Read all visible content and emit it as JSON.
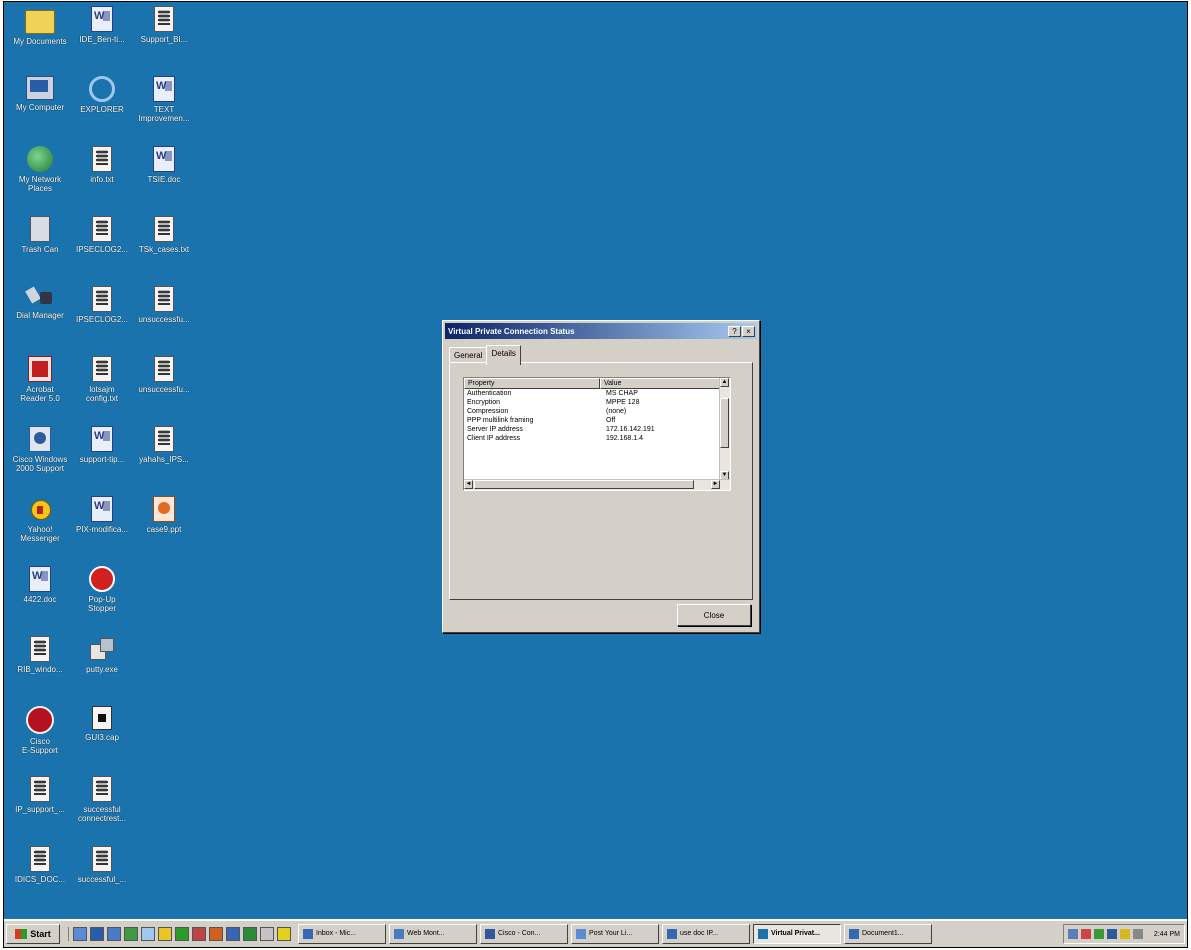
{
  "desktop": {
    "background_color": "#1a73ad",
    "icons": [
      {
        "label": "My Documents",
        "icon": "folder-icon",
        "col": 0,
        "row": 0
      },
      {
        "label": "IDE_Ben-ti...",
        "icon": "word-doc-icon",
        "col": 1,
        "row": 0
      },
      {
        "label": "Support_BI...",
        "icon": "text-file-icon",
        "col": 2,
        "row": 0
      },
      {
        "label": "My Computer",
        "icon": "computer-icon",
        "col": 0,
        "row": 1
      },
      {
        "label": "EXPLORER",
        "icon": "internet-explorer-icon",
        "col": 1,
        "row": 1
      },
      {
        "label": "TEXT\nImprovemen...",
        "icon": "word-doc-icon",
        "col": 2,
        "row": 1
      },
      {
        "label": "My Network\nPlaces",
        "icon": "network-places-icon",
        "col": 0,
        "row": 2
      },
      {
        "label": "info.txt",
        "icon": "text-file-icon",
        "col": 1,
        "row": 2
      },
      {
        "label": "TSIE.doc",
        "icon": "word-doc-icon",
        "col": 2,
        "row": 2
      },
      {
        "label": "Trash Can",
        "icon": "recycle-bin-icon",
        "col": 0,
        "row": 3
      },
      {
        "label": "IPSECLOG2...",
        "icon": "text-file-icon",
        "col": 1,
        "row": 3
      },
      {
        "label": "TSk_cases.txt",
        "icon": "text-file-icon",
        "col": 2,
        "row": 3
      },
      {
        "label": "Dial Manager",
        "icon": "dial-manager-icon",
        "col": 0,
        "row": 4
      },
      {
        "label": "IPSECLOG2...",
        "icon": "text-file-icon",
        "col": 1,
        "row": 4
      },
      {
        "label": "unsuccessfu...",
        "icon": "text-file-icon",
        "col": 2,
        "row": 4
      },
      {
        "label": "Acrobat\nReader 5.0",
        "icon": "acrobat-icon",
        "col": 0,
        "row": 5
      },
      {
        "label": "lotsajm\nconfig.txt",
        "icon": "text-file-icon",
        "col": 1,
        "row": 5
      },
      {
        "label": "unsuccessfu...",
        "icon": "text-file-icon",
        "col": 2,
        "row": 5
      },
      {
        "label": "Cisco Windows\n2000 Support",
        "icon": "cisco-vpn-icon",
        "col": 0,
        "row": 6
      },
      {
        "label": "support-tip...",
        "icon": "word-doc-icon",
        "col": 1,
        "row": 6
      },
      {
        "label": "yahahs_IPS...",
        "icon": "text-file-icon",
        "col": 2,
        "row": 6
      },
      {
        "label": "Yahoo!\nMessenger",
        "icon": "yahoo-messenger-icon",
        "col": 0,
        "row": 7
      },
      {
        "label": "PIX-modifica...",
        "icon": "word-doc-icon",
        "col": 1,
        "row": 7
      },
      {
        "label": "case9.ppt",
        "icon": "powerpoint-icon",
        "col": 2,
        "row": 7
      },
      {
        "label": "4422.doc",
        "icon": "word-doc-icon",
        "col": 0,
        "row": 8
      },
      {
        "label": "Pop-Up\nStopper",
        "icon": "popup-stopper-icon",
        "col": 1,
        "row": 8
      },
      {
        "label": "RIB_windo...",
        "icon": "text-file-icon",
        "col": 0,
        "row": 9
      },
      {
        "label": "putty.exe",
        "icon": "putty-icon",
        "col": 1,
        "row": 9
      },
      {
        "label": "Cisco\nE-Support",
        "icon": "cisco-support-icon",
        "col": 0,
        "row": 10
      },
      {
        "label": "GUI3.cap",
        "icon": "capture-file-icon",
        "col": 1,
        "row": 10
      },
      {
        "label": "IP_support_...",
        "icon": "text-file-icon",
        "col": 0,
        "row": 11
      },
      {
        "label": "successful\nconnectrest...",
        "icon": "text-file-icon",
        "col": 1,
        "row": 11
      },
      {
        "label": "IDICS_DOC...",
        "icon": "text-file-icon",
        "col": 0,
        "row": 12
      },
      {
        "label": "successful_...",
        "icon": "text-file-icon",
        "col": 1,
        "row": 12
      }
    ]
  },
  "dialog": {
    "title": "Virtual Private Connection Status",
    "title_buttons": [
      "?",
      "×"
    ],
    "tabs": [
      {
        "label": "General",
        "active": false
      },
      {
        "label": "Details",
        "active": true
      }
    ],
    "list": {
      "columns": [
        "Property",
        "Value"
      ],
      "rows": [
        [
          "Authentication",
          "MS CHAP"
        ],
        [
          "Encryption",
          "MPPE 128"
        ],
        [
          "Compression",
          "(none)"
        ],
        [
          "PPP multilink framing",
          "Off"
        ],
        [
          "Server IP address",
          "172.16.142.191"
        ],
        [
          "Client IP address",
          "192.168.1.4"
        ]
      ]
    },
    "close_label": "Close"
  },
  "taskbar": {
    "start_label": "Start",
    "tasks": [
      {
        "label": "Inbox - Mic...",
        "active": false
      },
      {
        "label": "Web Mont...",
        "active": false
      },
      {
        "label": "Cisco - Con...",
        "active": false
      },
      {
        "label": "Post Your Li...",
        "active": false
      },
      {
        "label": "use doc IP...",
        "active": false
      },
      {
        "label": "Virtual Privat...",
        "active": true
      },
      {
        "label": "Document1...",
        "active": false
      }
    ],
    "clock": "2:44 PM"
  }
}
